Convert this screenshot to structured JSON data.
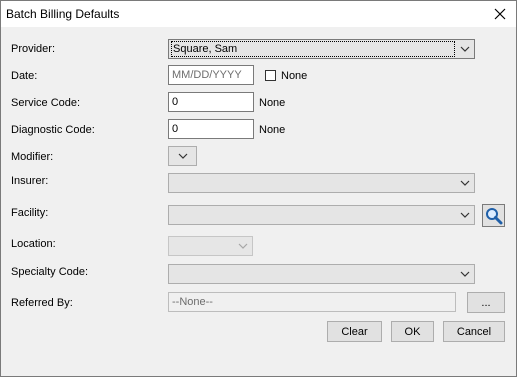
{
  "window": {
    "title": "Batch Billing Defaults",
    "close_icon": "close-icon"
  },
  "fields": {
    "provider": {
      "label": "Provider:",
      "value": "Square, Sam"
    },
    "date": {
      "label": "Date:",
      "placeholder": "MM/DD/YYYY",
      "none_label": "None",
      "none_checked": false
    },
    "service_code": {
      "label": "Service Code:",
      "value": "0",
      "none_label": "None"
    },
    "diagnostic_code": {
      "label": "Diagnostic Code:",
      "value": "0",
      "none_label": "None"
    },
    "modifier": {
      "label": "Modifier:",
      "value": ""
    },
    "insurer": {
      "label": "Insurer:",
      "value": ""
    },
    "facility": {
      "label": "Facility:",
      "value": "",
      "search_icon": "magnifier-icon"
    },
    "location": {
      "label": "Location:",
      "value": ""
    },
    "specialty_code": {
      "label": "Specialty Code:",
      "value": ""
    },
    "referred_by": {
      "label": "Referred By:",
      "value": "--None--",
      "browse_label": "..."
    }
  },
  "buttons": {
    "clear": "Clear",
    "ok": "OK",
    "cancel": "Cancel"
  }
}
